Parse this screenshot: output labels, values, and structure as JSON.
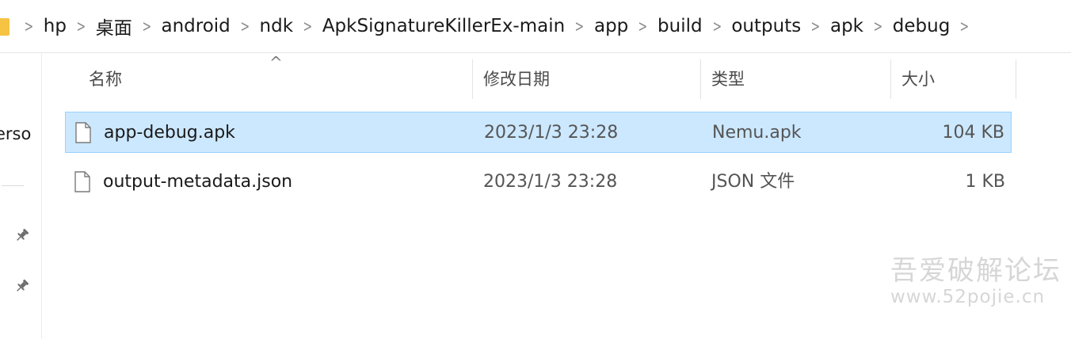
{
  "breadcrumb": {
    "separator": ">",
    "items": [
      "hp",
      "桌面",
      "android",
      "ndk",
      "ApkSignatureKillerEx-main",
      "app",
      "build",
      "outputs",
      "apk",
      "debug"
    ]
  },
  "nav": {
    "partial_label": "erso",
    "pin_icon": "pin-icon"
  },
  "columns": {
    "name": "名称",
    "date": "修改日期",
    "type": "类型",
    "size": "大小",
    "sort_indicator": "^"
  },
  "files": [
    {
      "name": "app-debug.apk",
      "date": "2023/1/3 23:28",
      "type": "Nemu.apk",
      "size": "104 KB",
      "selected": true
    },
    {
      "name": "output-metadata.json",
      "date": "2023/1/3 23:28",
      "type": "JSON 文件",
      "size": "1 KB",
      "selected": false
    }
  ],
  "watermark": {
    "line1": "吾爱破解论坛",
    "line2": "www.52pojie.cn"
  },
  "colors": {
    "selection_bg": "#cce8ff",
    "selection_border": "#99d1ff",
    "folder": "#f6c343"
  }
}
